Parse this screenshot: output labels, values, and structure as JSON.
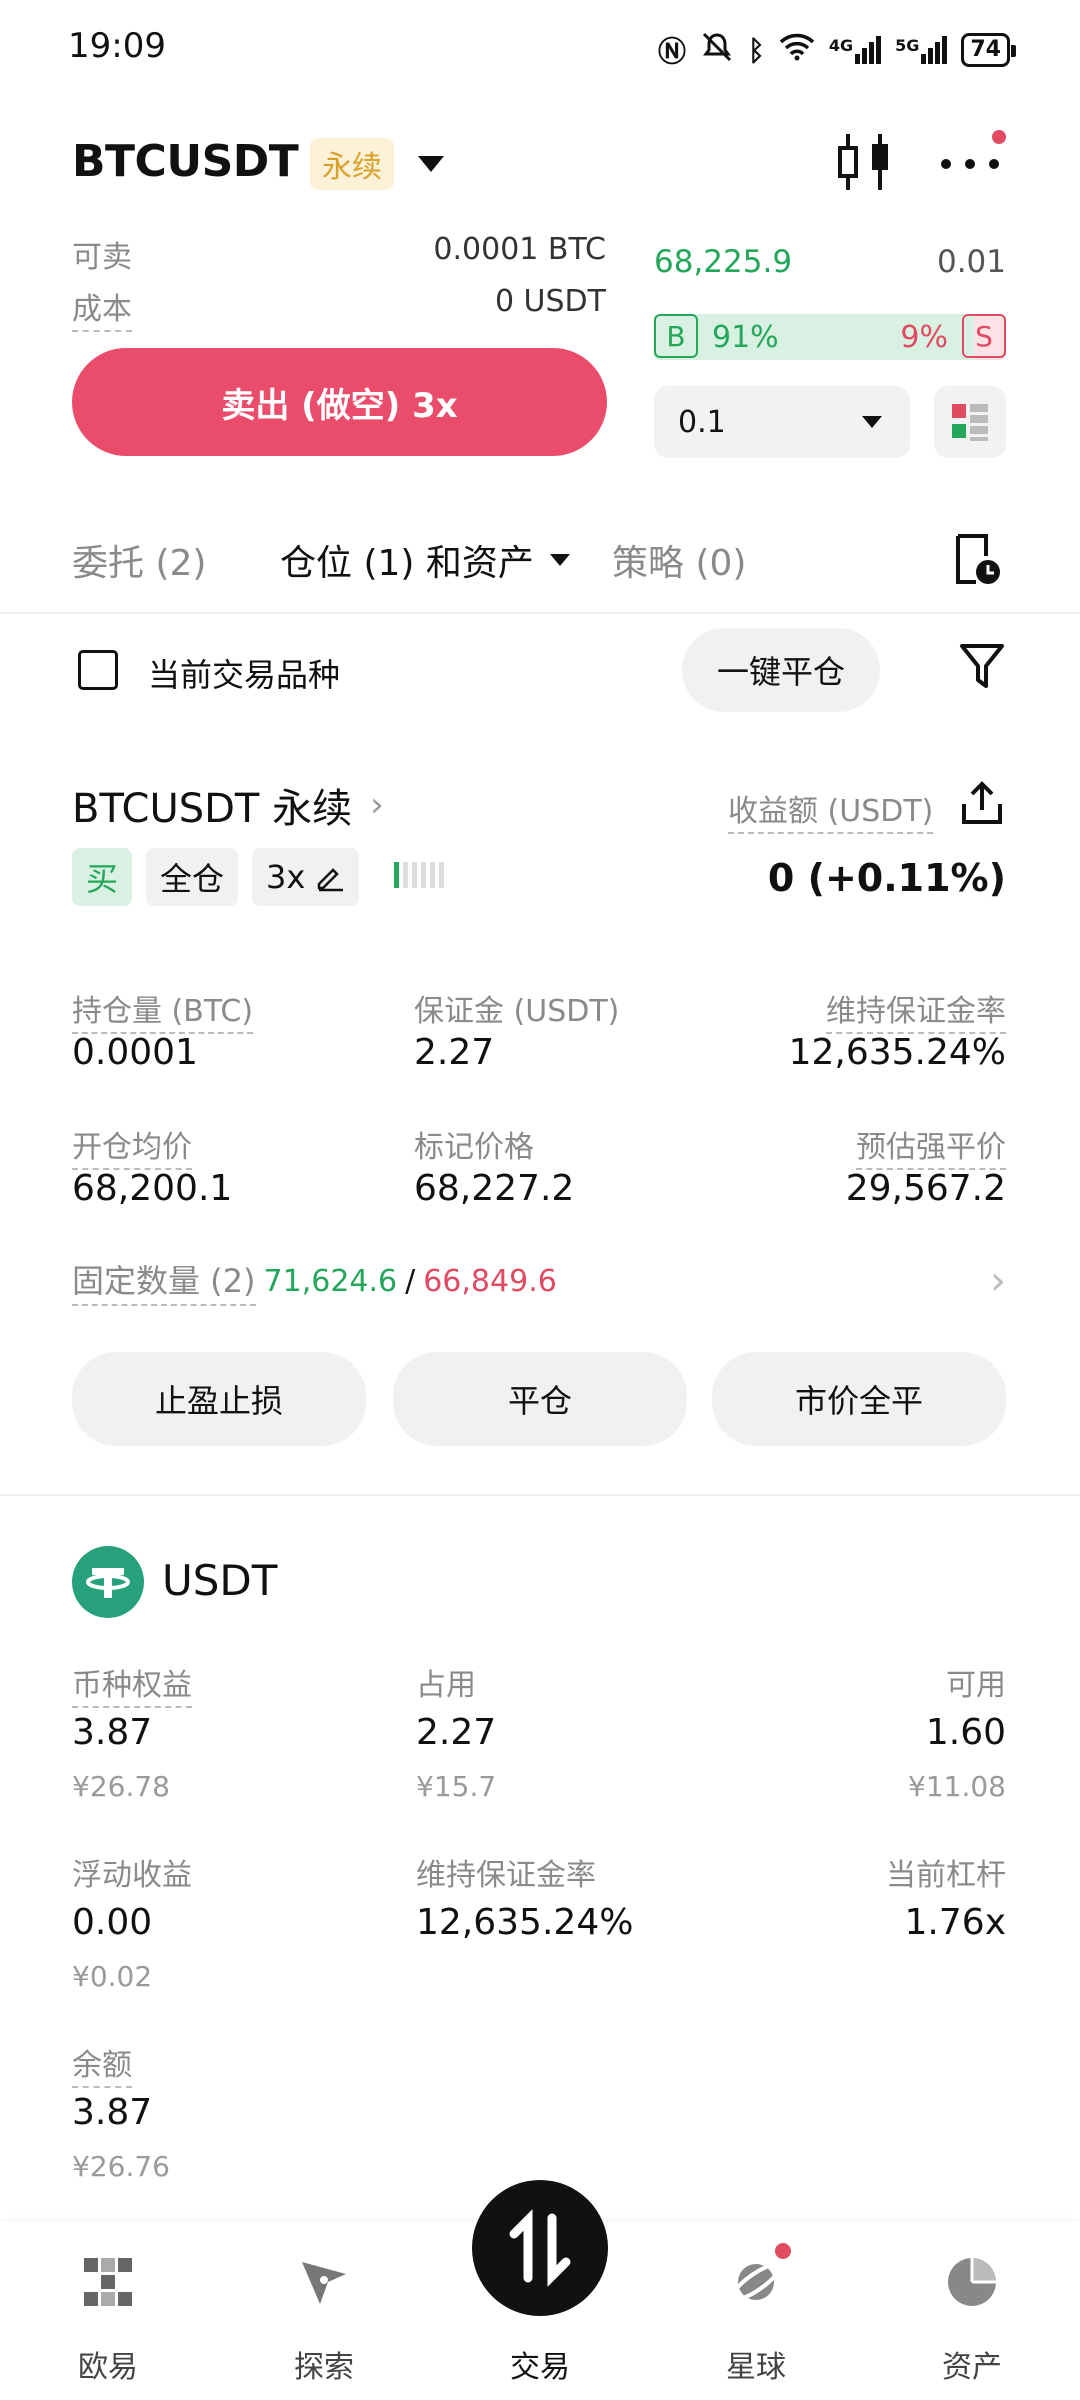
{
  "status_bar": {
    "time": "19:09",
    "battery": "74",
    "net1": "4G",
    "net2": "5G"
  },
  "header": {
    "symbol": "BTCUSDT",
    "badge": "永续"
  },
  "order": {
    "sellable_label": "可卖",
    "sellable_value": "0.0001 BTC",
    "cost_label": "成本",
    "cost_value": "0 USDT",
    "sell_button": "卖出 (做空) 3x",
    "last_price": "68,225.9",
    "price_step": "0.01",
    "buy_tag": "B",
    "buy_ratio": "91%",
    "sell_ratio": "9%",
    "sell_tag": "S",
    "buy_fraction": 0.91,
    "quantity": "0.1"
  },
  "tabs": [
    {
      "label": "委托 (2)"
    },
    {
      "label": "仓位 (1) 和资产"
    },
    {
      "label": "策略 (0)"
    }
  ],
  "filter": {
    "current_only": "当前交易品种",
    "close_all": "一键平仓"
  },
  "position": {
    "title": "BTCUSDT 永续",
    "pnl_label": "收益额 (USDT)",
    "pnl_value": "0 (+0.11%)",
    "side_tag": "买",
    "margin_mode": "全仓",
    "leverage": "3x",
    "fields": [
      {
        "label": "持仓量 (BTC)",
        "value": "0.0001"
      },
      {
        "label": "保证金 (USDT)",
        "value": "2.27"
      },
      {
        "label": "维持保证金率",
        "value": "12,635.24%"
      },
      {
        "label": "开仓均价",
        "value": "68,200.1"
      },
      {
        "label": "标记价格",
        "value": "68,227.2"
      },
      {
        "label": "预估强平价",
        "value": "29,567.2"
      }
    ],
    "tpsl_label": "固定数量 (2)",
    "tp_price": "71,624.6",
    "sep": "/",
    "sl_price": "66,849.6",
    "buttons": {
      "tpsl": "止盈止损",
      "close": "平仓",
      "market_close": "市价全平"
    }
  },
  "asset": {
    "currency": "USDT",
    "fields": [
      {
        "label": "币种权益",
        "value": "3.87",
        "sub": "¥26.78"
      },
      {
        "label": "占用",
        "value": "2.27",
        "sub": "¥15.7"
      },
      {
        "label": "可用",
        "value": "1.60",
        "sub": "¥11.08"
      },
      {
        "label": "浮动收益",
        "value": "0.00",
        "sub": "¥0.02"
      },
      {
        "label": "维持保证金率",
        "value": "12,635.24%",
        "sub": ""
      },
      {
        "label": "当前杠杆",
        "value": "1.76x",
        "sub": ""
      },
      {
        "label": "余额",
        "value": "3.87",
        "sub": "¥26.76"
      }
    ]
  },
  "nav": [
    {
      "label": "欧易",
      "icon": "okx-logo-icon"
    },
    {
      "label": "探索",
      "icon": "compass-icon"
    },
    {
      "label": "交易",
      "icon": "trade-arrows-icon"
    },
    {
      "label": "星球",
      "icon": "planet-icon"
    },
    {
      "label": "资产",
      "icon": "pie-chart-icon"
    }
  ],
  "colors": {
    "buy": "#25a75b",
    "sell": "#e04b62",
    "sell_button": "#ea4d6c"
  }
}
